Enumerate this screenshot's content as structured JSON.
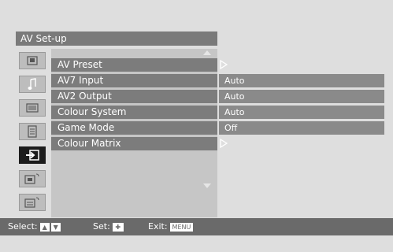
{
  "title": "AV Set-up",
  "sidebar": {
    "icons": [
      {
        "name": "picture-icon",
        "active": false
      },
      {
        "name": "sound-music-note-icon",
        "active": false
      },
      {
        "name": "screen-icon",
        "active": false
      },
      {
        "name": "features-list-icon",
        "active": false
      },
      {
        "name": "av-setup-input-icon",
        "active": true
      },
      {
        "name": "pc-setup-icon",
        "active": false
      },
      {
        "name": "settings-setup-icon",
        "active": false
      }
    ]
  },
  "menu": {
    "items": [
      {
        "label": "AV Preset",
        "value": "",
        "has_submenu": true
      },
      {
        "label": "AV7 Input",
        "value": "Auto",
        "has_submenu": false
      },
      {
        "label": "AV2 Output",
        "value": "Auto",
        "has_submenu": false
      },
      {
        "label": "Colour System",
        "value": "Auto",
        "has_submenu": false
      },
      {
        "label": "Game Mode",
        "value": "Off",
        "has_submenu": false
      },
      {
        "label": "Colour Matrix",
        "value": "",
        "has_submenu": true
      }
    ]
  },
  "footer": {
    "select_label": "Select:",
    "set_label": "Set:",
    "exit_label": "Exit:",
    "menu_key": "MENU"
  },
  "colors": {
    "background": "#dedede",
    "title_bar": "#7a7a7a",
    "row": "#7c7c7c",
    "value_box": "#8a8a8a",
    "status_bar": "#6a6a6a",
    "active_icon": "#1c1c1c"
  }
}
